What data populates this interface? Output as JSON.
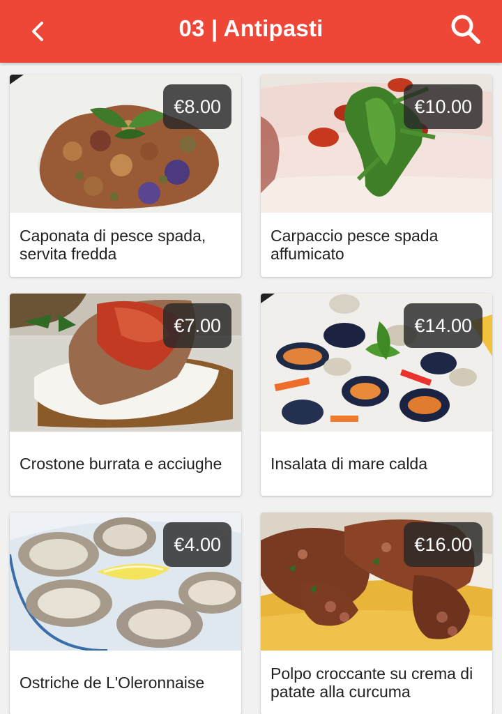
{
  "header": {
    "title": "03 | Antipasti",
    "back_icon": "chevron-left-icon",
    "search_icon": "search-icon",
    "background": "#ee4637"
  },
  "items": [
    {
      "name": "Caponata di pesce spada, servita fredda",
      "price": "€8.00"
    },
    {
      "name": "Carpaccio pesce spada affumicato",
      "price": "€10.00"
    },
    {
      "name": "Crostone burrata e acciughe",
      "price": "€7.00"
    },
    {
      "name": "Insalata di mare calda",
      "price": "€14.00"
    },
    {
      "name": "Ostriche de L'Oleronnaise",
      "price": "€4.00"
    },
    {
      "name": "Polpo croccante su crema di patate alla curcuma",
      "price": "€16.00"
    }
  ]
}
